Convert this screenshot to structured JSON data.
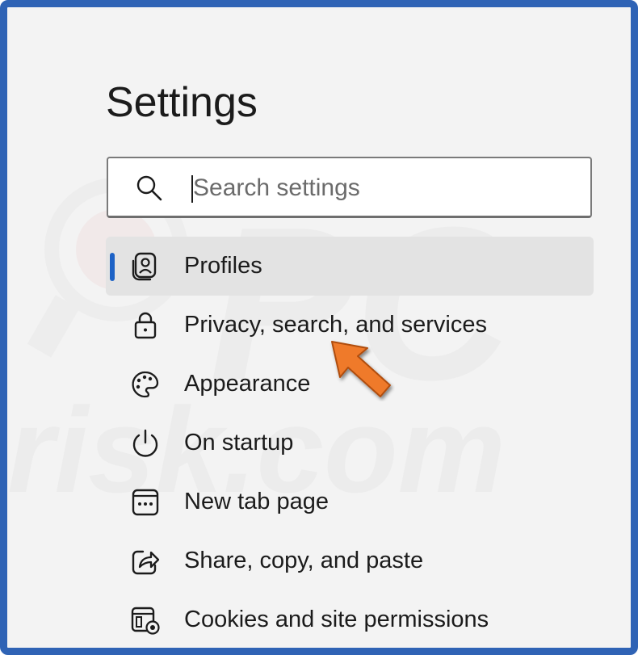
{
  "settings": {
    "title": "Settings",
    "search": {
      "placeholder": "Search settings",
      "icon": "search-icon"
    },
    "nav": {
      "items": [
        {
          "label": "Profiles",
          "icon": "profile-icon",
          "selected": true
        },
        {
          "label": "Privacy, search, and services",
          "icon": "lock-icon",
          "selected": false
        },
        {
          "label": "Appearance",
          "icon": "palette-icon",
          "selected": false
        },
        {
          "label": "On startup",
          "icon": "power-icon",
          "selected": false
        },
        {
          "label": "New tab page",
          "icon": "new-tab-icon",
          "selected": false
        },
        {
          "label": "Share, copy, and paste",
          "icon": "share-icon",
          "selected": false
        },
        {
          "label": "Cookies and site permissions",
          "icon": "cookies-icon",
          "selected": false
        }
      ]
    }
  },
  "colors": {
    "frame_border": "#2f63b5",
    "background": "#f3f3f3",
    "selected_row": "#e3e3e3",
    "selection_indicator": "#1d62c6",
    "annotation_arrow": "#ef7a2a"
  },
  "watermark": {
    "text_top": "PC",
    "text_bottom": "risk.com"
  }
}
